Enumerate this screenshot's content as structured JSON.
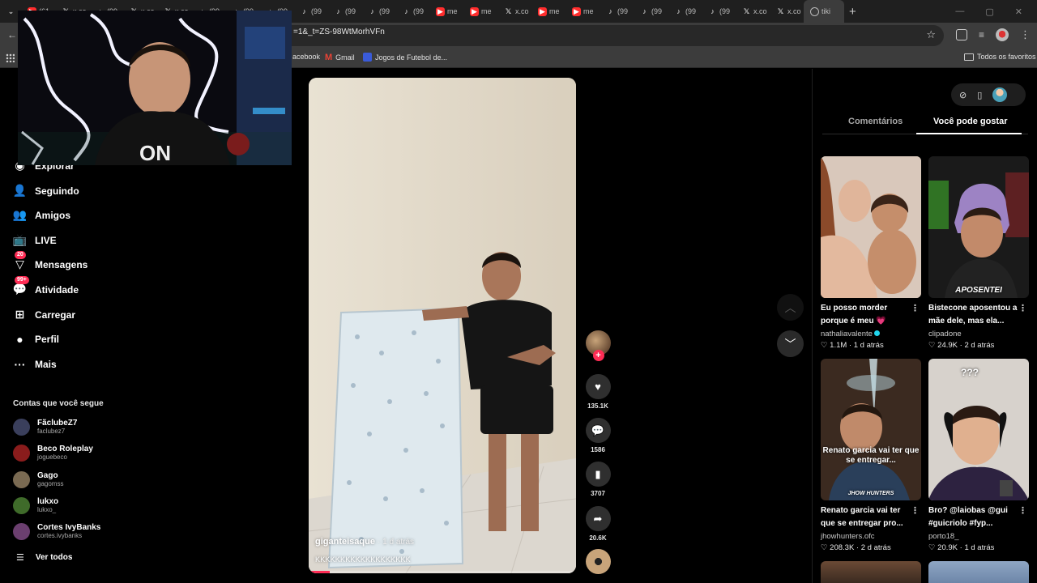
{
  "browser": {
    "tabs": [
      {
        "icon": "youtube",
        "label": "(61"
      },
      {
        "icon": "x",
        "label": "x.co"
      },
      {
        "icon": "tiktok",
        "label": "(99"
      },
      {
        "icon": "x",
        "label": "x.co"
      },
      {
        "icon": "x",
        "label": "x.co"
      },
      {
        "icon": "tiktok",
        "label": "(99"
      },
      {
        "icon": "tiktok",
        "label": "(99"
      },
      {
        "icon": "tiktok",
        "label": "(99"
      },
      {
        "icon": "tiktok",
        "label": "(99"
      },
      {
        "icon": "tiktok",
        "label": "(99"
      },
      {
        "icon": "tiktok",
        "label": "(99"
      },
      {
        "icon": "tiktok",
        "label": "(99"
      },
      {
        "icon": "youtube",
        "label": "me"
      },
      {
        "icon": "youtube",
        "label": "me"
      },
      {
        "icon": "x",
        "label": "x.co"
      },
      {
        "icon": "youtube",
        "label": "me"
      },
      {
        "icon": "youtube",
        "label": "me"
      },
      {
        "icon": "tiktok",
        "label": "(99"
      },
      {
        "icon": "tiktok",
        "label": "(99"
      },
      {
        "icon": "tiktok",
        "label": "(99"
      },
      {
        "icon": "tiktok",
        "label": "(99"
      },
      {
        "icon": "x",
        "label": "x.co"
      },
      {
        "icon": "x",
        "label": "x.co"
      },
      {
        "icon": "globe",
        "label": "tiki"
      }
    ],
    "new_tab": "+",
    "url_visible": "=1&_t=ZS-98WtMorhVFn",
    "bookmarks": {
      "facebook": "acebook",
      "gmail": "Gmail",
      "jogos": "Jogos de Futebol de...",
      "todos": "Todos os favoritos"
    }
  },
  "sidebar": {
    "nav": [
      {
        "icon": "compass-icon",
        "glyph": "◉",
        "label": "Explorar"
      },
      {
        "icon": "following-icon",
        "glyph": "👤",
        "label": "Seguindo"
      },
      {
        "icon": "friends-icon",
        "glyph": "👥",
        "label": "Amigos"
      },
      {
        "icon": "live-icon",
        "glyph": "📺",
        "label": "LIVE"
      },
      {
        "icon": "messages-icon",
        "glyph": "▽",
        "label": "Mensagens",
        "badge": "20"
      },
      {
        "icon": "activity-icon",
        "glyph": "💬",
        "label": "Atividade",
        "badge": "99+"
      },
      {
        "icon": "upload-icon",
        "glyph": "⊞",
        "label": "Carregar"
      },
      {
        "icon": "profile-icon",
        "glyph": "●",
        "label": "Perfil"
      },
      {
        "icon": "more-icon",
        "glyph": "···",
        "label": "Mais"
      }
    ],
    "following_title": "Contas que você segue",
    "following": [
      {
        "name": "FãclubeZ7",
        "handle": "faclubez7",
        "color": "#3a3f5c"
      },
      {
        "name": "Beco Roleplay",
        "handle": "joguebeco",
        "color": "#8a1c1c"
      },
      {
        "name": "Gago",
        "handle": "gagomss",
        "color": "#7a6a52"
      },
      {
        "name": "lukxo",
        "handle": "lukxo_",
        "color": "#3f6b2a"
      },
      {
        "name": "Cortes IvyBanks",
        "handle": "cortes.ivybanks",
        "color": "#6b3f6f"
      }
    ],
    "see_all": "Ver todos"
  },
  "video": {
    "author": "giganteisaque",
    "age": "· 1 d atrás",
    "caption": "KKKKKKKKKKKKKKKKKKK",
    "progress": 0.08
  },
  "actions": {
    "likes": "135.1K",
    "comments": "1586",
    "saves": "3707",
    "shares": "20.6K"
  },
  "right_panel": {
    "tab_comments": "Comentários",
    "tab_suggested": "Você pode gostar",
    "cards": [
      {
        "title": "Eu posso morder porque é meu 💗",
        "author": "nathaliavalente",
        "verified": true,
        "likes": "1.1M",
        "age": "1 d atrás",
        "overlay": ""
      },
      {
        "title": "Bistecone aposentou a mãe dele, mas ela...",
        "author": "clipadone",
        "verified": false,
        "likes": "24.9K",
        "age": "2 d atrás",
        "overlay": "APOSENTEI"
      },
      {
        "title": "Renato garcia vai ter que se entregar pro...",
        "author": "jhowhunters.ofc",
        "verified": false,
        "likes": "208.3K",
        "age": "2 d atrás",
        "overlay": "Renato garcia vai ter que se entregar...",
        "overlay2": "JHOW HUNTERS"
      },
      {
        "title": "Bro? @laiobas @gui #guicriolo #fyp...",
        "author": "porto18_",
        "verified": false,
        "likes": "20.9K",
        "age": "1 d atrás",
        "overlay": "???"
      }
    ]
  }
}
